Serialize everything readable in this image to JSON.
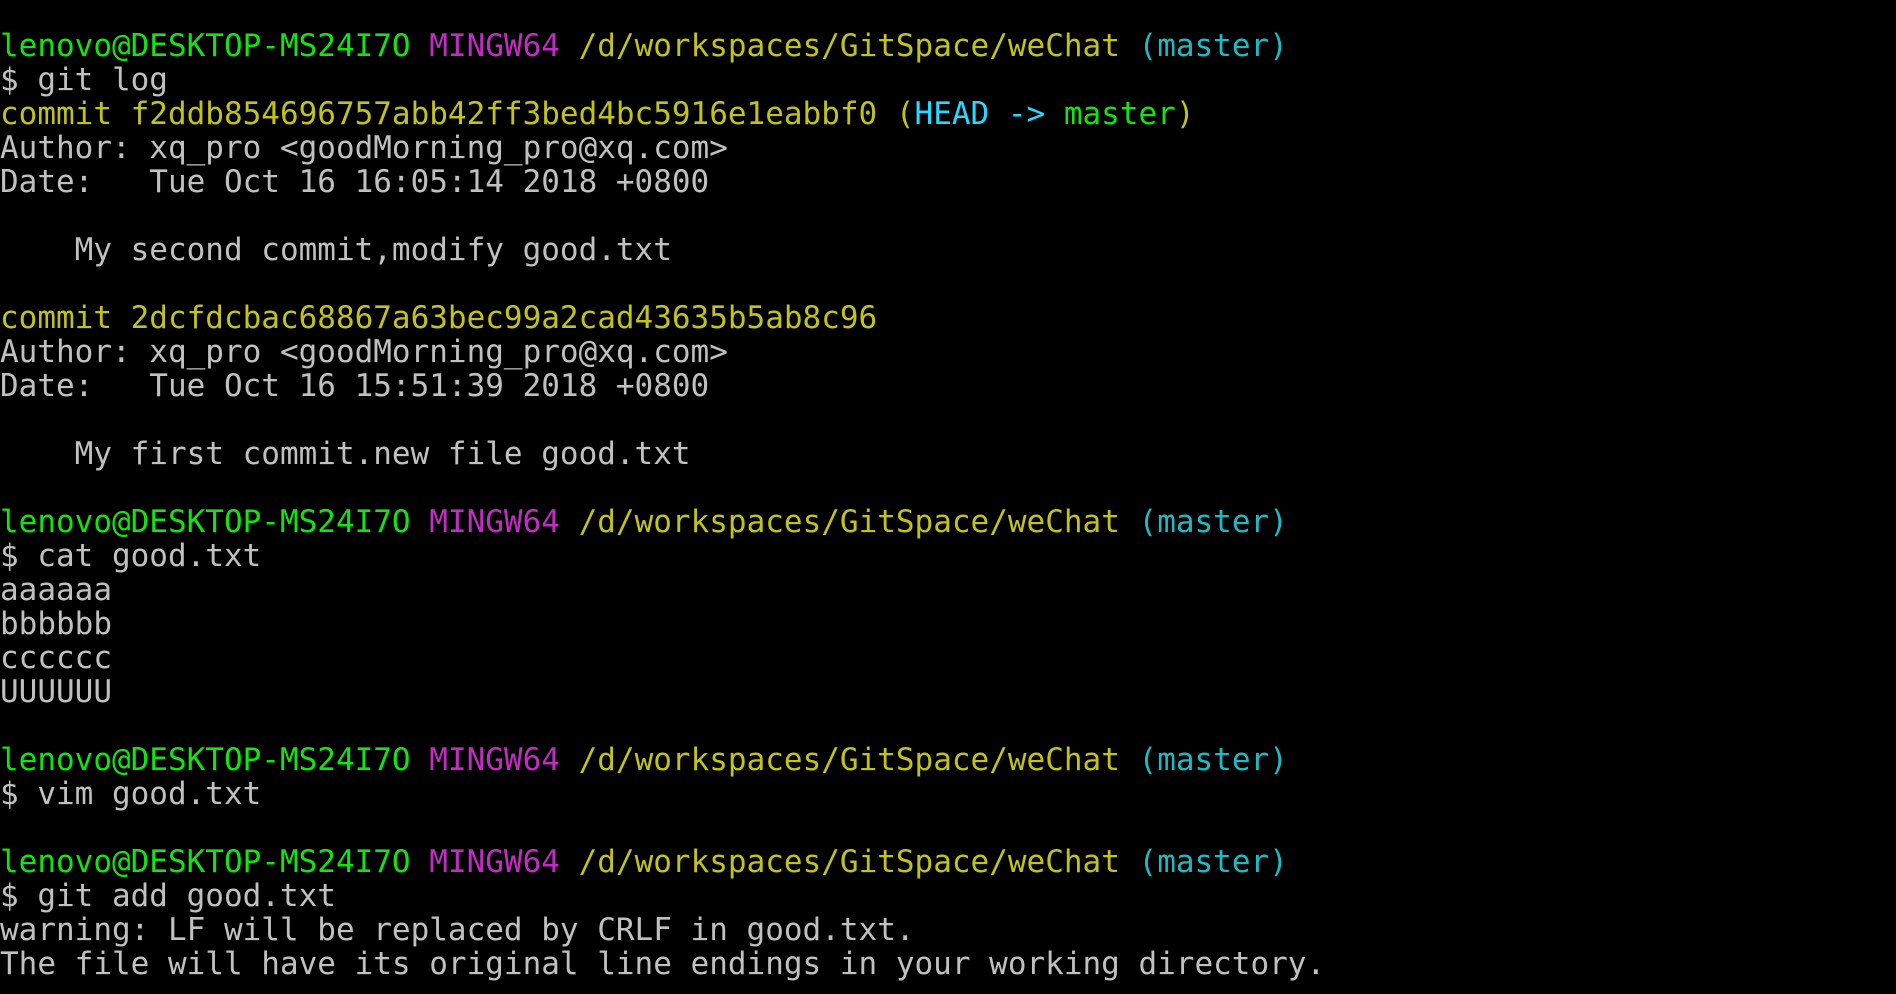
{
  "colors": {
    "background": "#000000",
    "text": "#c0c0c0",
    "user_host": "#11e411",
    "system": "#c12dc1",
    "path": "#c2c21c",
    "branch": "#1fb9c1",
    "commit_hash": "#c2c21c",
    "head": "#25d9ff",
    "master_ref": "#11e411"
  },
  "prompt": {
    "user_host": "lenovo@DESKTOP-MS24I7O",
    "system": "MINGW64",
    "path": "/d/workspaces/GitSpace/weChat",
    "branch": "(master)"
  },
  "lines": [
    {
      "type": "prompt"
    },
    {
      "type": "command",
      "text": "$ git log"
    },
    {
      "type": "commit",
      "prefix": "commit f2ddb854696757abb42ff3bed4bc5916e1eabbf0",
      "open": " (",
      "head": "HEAD ->",
      "ref": " master",
      "close": ")"
    },
    {
      "type": "text",
      "text": "Author: xq_pro <goodMorning_pro@xq.com>"
    },
    {
      "type": "text",
      "text": "Date:   Tue Oct 16 16:05:14 2018 +0800"
    },
    {
      "type": "blank"
    },
    {
      "type": "text",
      "text": "    My second commit,modify good.txt"
    },
    {
      "type": "blank"
    },
    {
      "type": "commit",
      "prefix": "commit 2dcfdcbac68867a63bec99a2cad43635b5ab8c96"
    },
    {
      "type": "text",
      "text": "Author: xq_pro <goodMorning_pro@xq.com>"
    },
    {
      "type": "text",
      "text": "Date:   Tue Oct 16 15:51:39 2018 +0800"
    },
    {
      "type": "blank"
    },
    {
      "type": "text",
      "text": "    My first commit.new file good.txt"
    },
    {
      "type": "blank"
    },
    {
      "type": "prompt"
    },
    {
      "type": "command",
      "text": "$ cat good.txt"
    },
    {
      "type": "text",
      "text": "aaaaaa"
    },
    {
      "type": "text",
      "text": "bbbbbb"
    },
    {
      "type": "text",
      "text": "cccccc"
    },
    {
      "type": "text",
      "text": "UUUUUU"
    },
    {
      "type": "blank"
    },
    {
      "type": "prompt"
    },
    {
      "type": "command",
      "text": "$ vim good.txt"
    },
    {
      "type": "blank"
    },
    {
      "type": "prompt"
    },
    {
      "type": "command",
      "text": "$ git add good.txt"
    },
    {
      "type": "text",
      "text": "warning: LF will be replaced by CRLF in good.txt."
    },
    {
      "type": "text",
      "text": "The file will have its original line endings in your working directory."
    }
  ]
}
